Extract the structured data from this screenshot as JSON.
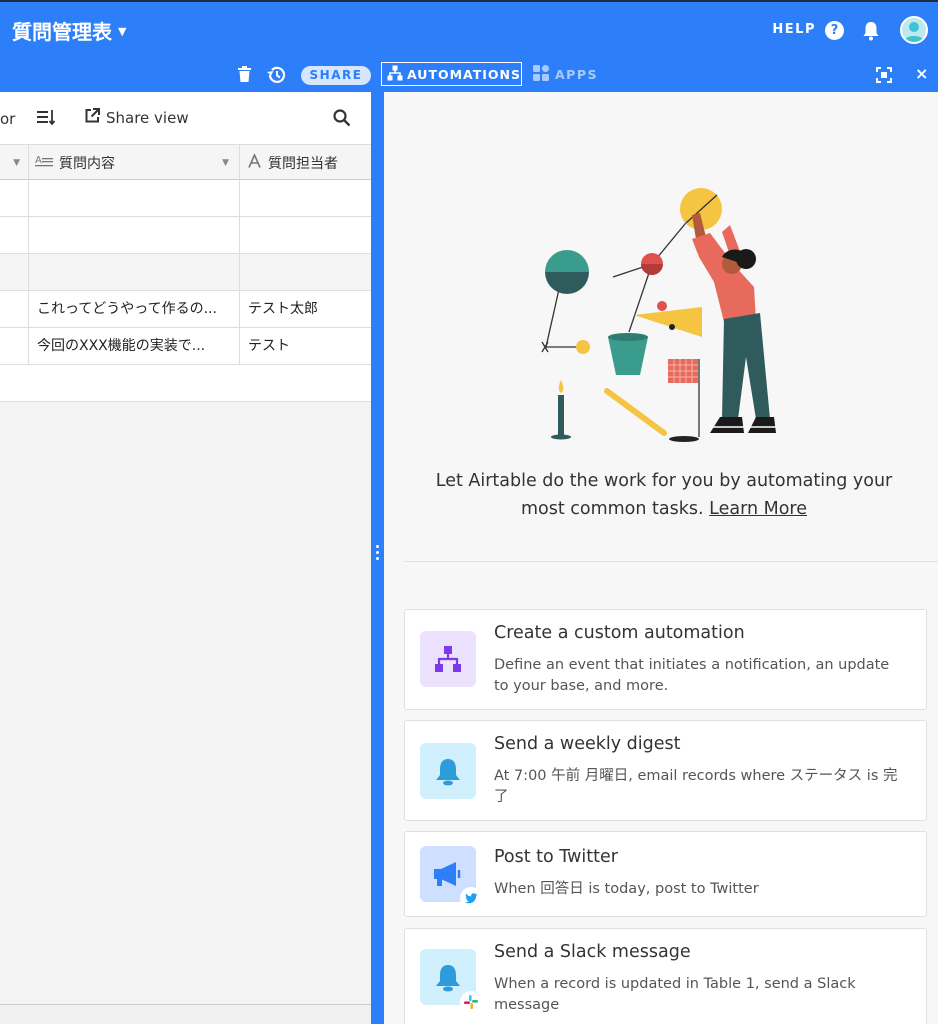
{
  "header": {
    "base_title": "質問管理表",
    "help_label": "HELP",
    "help_glyph": "?"
  },
  "toolbar": {
    "share_label": "SHARE",
    "automations_label": "AUTOMATIONS",
    "apps_label": "APPS",
    "close_glyph": "×"
  },
  "grid": {
    "toolbar_partial": "or",
    "share_view_label": "Share view",
    "columns": [
      {
        "label": "質問内容",
        "icon": "long-text-icon"
      },
      {
        "label": "質問担当者",
        "icon": "text-field-icon"
      }
    ],
    "rows": [
      {
        "content": "",
        "assignee": ""
      },
      {
        "content": "",
        "assignee": ""
      },
      {
        "content": "",
        "assignee": ""
      },
      {
        "content": "これってどうやって作るの...",
        "assignee": "テスト太郎"
      },
      {
        "content": "今回のXXX機能の実装で...",
        "assignee": "テスト"
      }
    ]
  },
  "automations": {
    "intro_text": "Let Airtable do the work for you by automating your most common tasks.",
    "learn_more": "Learn More",
    "cards": [
      {
        "title": "Create a custom automation",
        "description": "Define an event that initiates a notification, an update to your base, and more.",
        "icon": "flow-icon",
        "icon_bg": "#ede2fe",
        "icon_color": "#7c3aed"
      },
      {
        "title": "Send a weekly digest",
        "description": "At 7:00 午前 月曜日, email records where ステータス is 完了",
        "icon": "bell-icon",
        "icon_bg": "#d0f0fd",
        "icon_color": "#2d9cdb"
      },
      {
        "title": "Post to Twitter",
        "description": "When 回答日 is today, post to Twitter",
        "icon": "megaphone-icon",
        "icon_bg": "#cfdfff",
        "icon_color": "#2d7ff9",
        "badge": "twitter-icon"
      },
      {
        "title": "Send a Slack message",
        "description": "When a record is updated in Table 1, send a Slack message",
        "icon": "bell-icon",
        "icon_bg": "#d0f0fd",
        "icon_color": "#2d9cdb",
        "badge": "slack-icon"
      }
    ]
  },
  "colors": {
    "brand_blue": "#2d7ff9",
    "share_pill_bg": "#d5e6fe"
  }
}
